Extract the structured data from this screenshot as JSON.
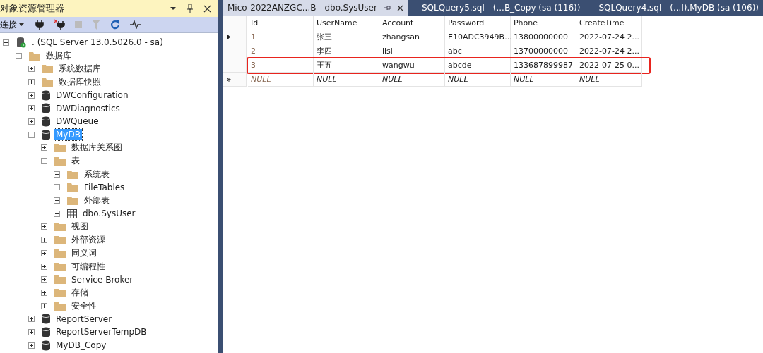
{
  "explorer": {
    "title": "对象资源管理器",
    "connect_label": "连接",
    "tree": [
      {
        "label": ". (SQL Server 13.0.5026.0 - sa)",
        "kind": "server",
        "expanded": true,
        "selected": false,
        "children": [
          {
            "label": "数据库",
            "kind": "folder",
            "expanded": true,
            "selected": false,
            "children": [
              {
                "label": "系统数据库",
                "kind": "folder",
                "expanded": false,
                "selected": false
              },
              {
                "label": "数据库快照",
                "kind": "folder",
                "expanded": false,
                "selected": false
              },
              {
                "label": "DWConfiguration",
                "kind": "database",
                "expanded": false,
                "selected": false
              },
              {
                "label": "DWDiagnostics",
                "kind": "database",
                "expanded": false,
                "selected": false
              },
              {
                "label": "DWQueue",
                "kind": "database",
                "expanded": false,
                "selected": false
              },
              {
                "label": "MyDB",
                "kind": "database",
                "expanded": true,
                "selected": true,
                "children": [
                  {
                    "label": "数据库关系图",
                    "kind": "folder",
                    "expanded": false,
                    "selected": false
                  },
                  {
                    "label": "表",
                    "kind": "folder",
                    "expanded": true,
                    "selected": false,
                    "children": [
                      {
                        "label": "系统表",
                        "kind": "folder",
                        "expanded": false,
                        "selected": false
                      },
                      {
                        "label": "FileTables",
                        "kind": "folder",
                        "expanded": false,
                        "selected": false
                      },
                      {
                        "label": "外部表",
                        "kind": "folder",
                        "expanded": false,
                        "selected": false
                      },
                      {
                        "label": "dbo.SysUser",
                        "kind": "table",
                        "expanded": false,
                        "selected": false
                      }
                    ]
                  },
                  {
                    "label": "视图",
                    "kind": "folder",
                    "expanded": false,
                    "selected": false
                  },
                  {
                    "label": "外部资源",
                    "kind": "folder",
                    "expanded": false,
                    "selected": false
                  },
                  {
                    "label": "同义词",
                    "kind": "folder",
                    "expanded": false,
                    "selected": false
                  },
                  {
                    "label": "可编程性",
                    "kind": "folder",
                    "expanded": false,
                    "selected": false
                  },
                  {
                    "label": "Service Broker",
                    "kind": "folder",
                    "expanded": false,
                    "selected": false
                  },
                  {
                    "label": "存储",
                    "kind": "folder",
                    "expanded": false,
                    "selected": false
                  },
                  {
                    "label": "安全性",
                    "kind": "folder",
                    "expanded": false,
                    "selected": false
                  }
                ]
              },
              {
                "label": "ReportServer",
                "kind": "database",
                "expanded": false,
                "selected": false
              },
              {
                "label": "ReportServerTempDB",
                "kind": "database",
                "expanded": false,
                "selected": false
              },
              {
                "label": "MyDB_Copy",
                "kind": "database",
                "expanded": false,
                "selected": false
              }
            ]
          }
        ]
      }
    ]
  },
  "tabs": [
    {
      "label": "Mico-2022ANZGC...B - dbo.SysUser",
      "selected": true
    },
    {
      "label": "SQLQuery5.sql - (...B_Copy (sa (116))",
      "selected": false
    },
    {
      "label": "SQLQuery4.sql - (...l).MyDB (sa (106))",
      "selected": false
    }
  ],
  "grid": {
    "columns": [
      "Id",
      "UserName",
      "Account",
      "Password",
      "Phone",
      "CreateTime"
    ],
    "rows": [
      {
        "current": true,
        "highlighted": false,
        "null_row": false,
        "cells": [
          "1",
          "张三",
          "zhangsan",
          "E10ADC3949B...",
          "13800000000",
          "2022-07-24 2..."
        ]
      },
      {
        "current": false,
        "highlighted": false,
        "null_row": false,
        "cells": [
          "2",
          "李四",
          "lisi",
          "abc",
          "13700000000",
          "2022-07-24 2..."
        ]
      },
      {
        "current": false,
        "highlighted": true,
        "null_row": false,
        "cells": [
          "3",
          "王五",
          "wangwu",
          "abcde",
          "133687899987",
          "2022-07-25 0..."
        ]
      },
      {
        "current": false,
        "highlighted": false,
        "null_row": true,
        "cells": [
          "NULL",
          "NULL",
          "NULL",
          "NULL",
          "NULL",
          "NULL"
        ]
      }
    ]
  }
}
